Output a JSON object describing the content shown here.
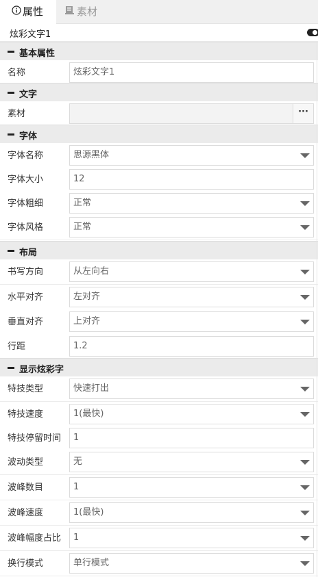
{
  "tabs": [
    {
      "label": "属性",
      "icon": "info-circle-icon",
      "active": true
    },
    {
      "label": "素材",
      "icon": "book-icon",
      "active": false
    }
  ],
  "object": {
    "name": "炫彩文字1",
    "toggle_on": true
  },
  "sections": {
    "basic": {
      "title": "基本属性",
      "fields": {
        "name": {
          "label": "名称",
          "value": "炫彩文字1"
        }
      }
    },
    "text": {
      "title": "文字",
      "fields": {
        "material": {
          "label": "素材",
          "value": "",
          "browse_label": "···"
        }
      }
    },
    "font": {
      "title": "字体",
      "fields": {
        "family": {
          "label": "字体名称",
          "value": "思源黑体"
        },
        "size": {
          "label": "字体大小",
          "value": "12"
        },
        "weight": {
          "label": "字体粗细",
          "value": "正常"
        },
        "style": {
          "label": "字体风格",
          "value": "正常"
        }
      }
    },
    "layout": {
      "title": "布局",
      "fields": {
        "direction": {
          "label": "书写方向",
          "value": "从左向右"
        },
        "halign": {
          "label": "水平对齐",
          "value": "左对齐"
        },
        "valign": {
          "label": "垂直对齐",
          "value": "上对齐"
        },
        "line_spacing": {
          "label": "行距",
          "value": "1.2"
        }
      }
    },
    "effect": {
      "title": "显示炫彩字",
      "fields": {
        "type": {
          "label": "特技类型",
          "value": "快速打出"
        },
        "speed": {
          "label": "特技速度",
          "value": "1(最快)"
        },
        "stay": {
          "label": "特技停留时间",
          "value": "1"
        },
        "wave_type": {
          "label": "波动类型",
          "value": "无"
        },
        "peak_count": {
          "label": "波峰数目",
          "value": "1"
        },
        "peak_speed": {
          "label": "波峰速度",
          "value": "1(最快)"
        },
        "peak_ratio": {
          "label": "波峰幅度占比",
          "value": "1"
        },
        "wrap_mode": {
          "label": "换行模式",
          "value": "单行模式"
        }
      }
    }
  }
}
